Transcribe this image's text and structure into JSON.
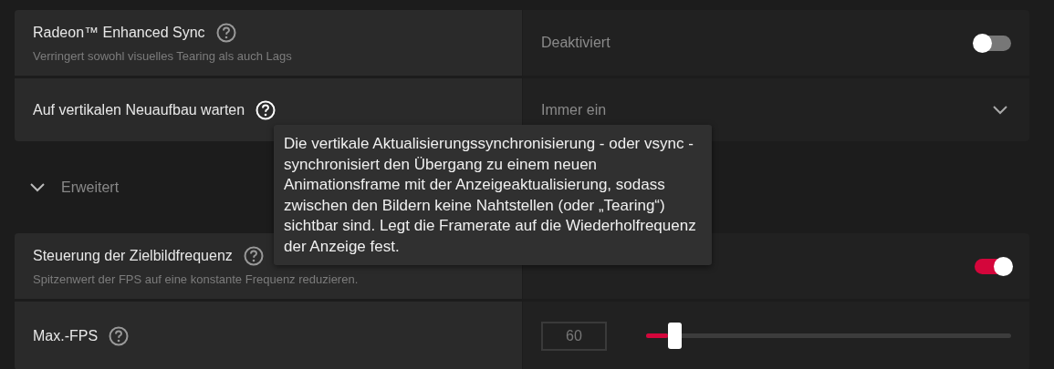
{
  "settings": [
    {
      "kind": "toggle",
      "label": "Radeon™ Enhanced Sync",
      "description": "Verringert sowohl visuelles Tearing als auch Lags",
      "help_highlighted": false,
      "value": "Deaktiviert",
      "on": false
    },
    {
      "kind": "dropdown",
      "label": "Auf vertikalen Neuaufbau warten",
      "help_highlighted": true,
      "value": "Immer ein"
    }
  ],
  "advanced": {
    "label": "Erweitert",
    "expanded": true
  },
  "advanced_settings": [
    {
      "kind": "toggle",
      "label": "Steuerung der Zielbildfrequenz",
      "description": "Spitzenwert der FPS auf eine konstante Frequenz reduzieren.",
      "help_highlighted": false,
      "on": true
    },
    {
      "kind": "slider",
      "label": "Max.-FPS",
      "help_highlighted": false,
      "value": "60",
      "level": 0.06
    }
  ],
  "tooltip": {
    "text": "Die vertikale Aktualisierungssynchronisierung - oder vsync - synchronisiert den Übergang zu einem neuen Animationsframe mit der Anzeigeaktualisierung, sodass zwischen den Bildern keine Nahtstellen (oder „Tearing“) sichtbar sind. Legt die Framerate auf die Wiederholfrequenz der Anzeige fest."
  }
}
